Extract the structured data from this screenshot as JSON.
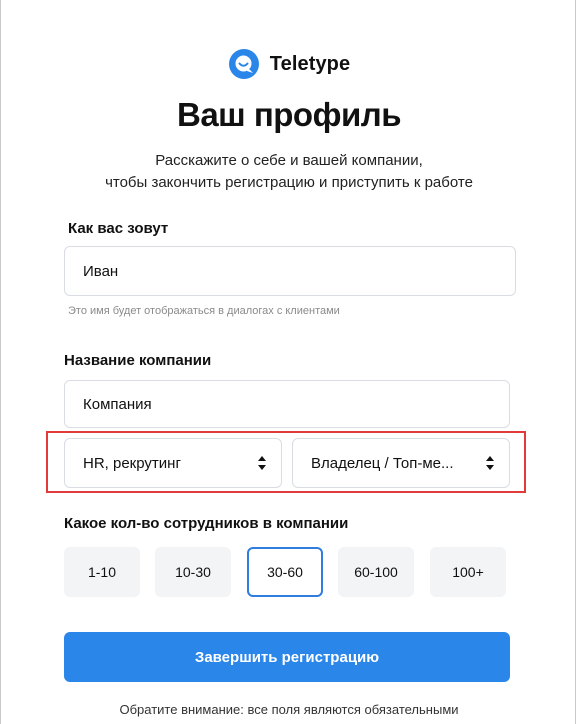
{
  "brand": {
    "name": "Teletype",
    "accent": "#2b86ea"
  },
  "header": {
    "title": "Ваш профиль",
    "subtitle_line1": "Расскажите о себе и вашей компании,",
    "subtitle_line2": "чтобы закончить регистрацию и приступить к работе"
  },
  "name_field": {
    "label": "Как вас зовут",
    "value": "Иван",
    "hint": "Это имя будет отображаться в диалогах с клиентами"
  },
  "company_field": {
    "label": "Название компании",
    "value": "Компания"
  },
  "selects": {
    "industry": "HR, рекрутинг",
    "role": "Владелец / Топ-ме..."
  },
  "employees": {
    "label": "Какое кол-во сотрудников в компании",
    "options": [
      "1-10",
      "10-30",
      "30-60",
      "60-100",
      "100+"
    ],
    "selected": "30-60"
  },
  "submit_label": "Завершить регистрацию",
  "footer_note": "Обратите внимание: все поля являются обязательными",
  "colors": {
    "selected_border": "#2f7de1",
    "highlight": "#e03a3a"
  }
}
